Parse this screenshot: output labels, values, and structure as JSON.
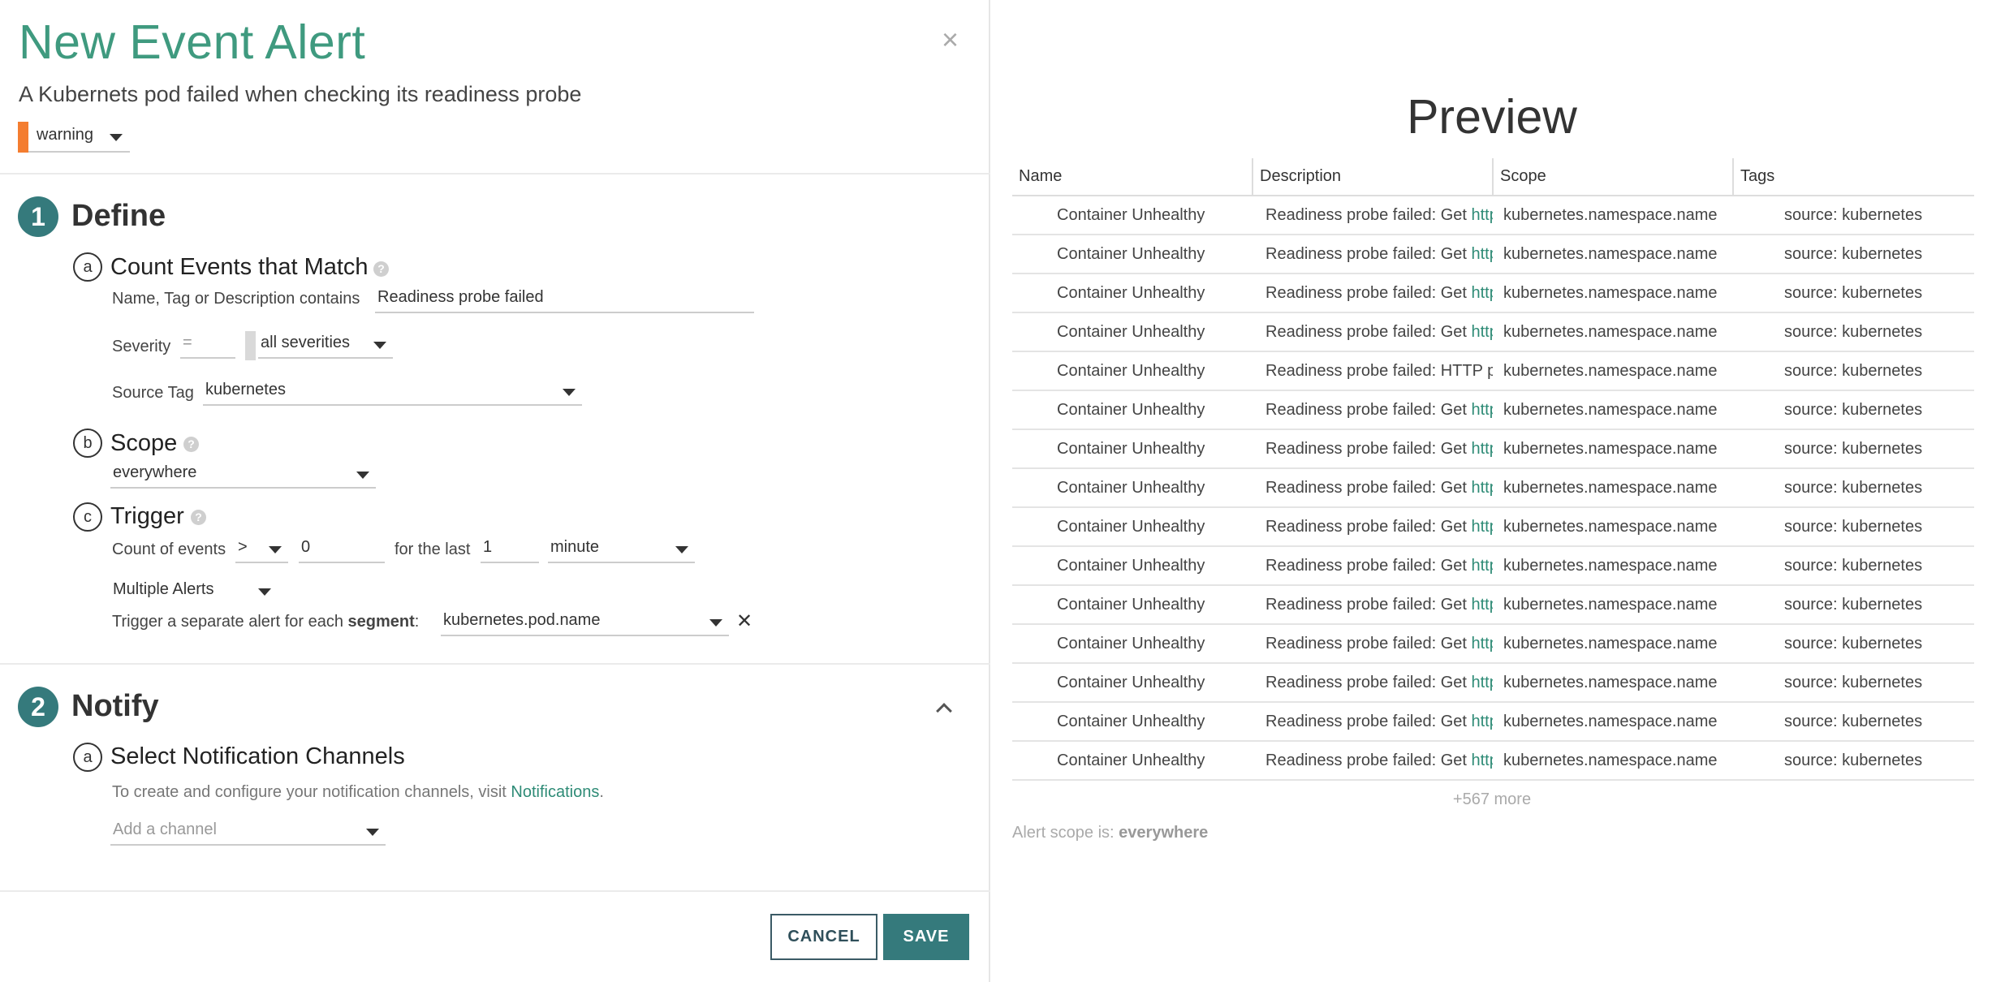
{
  "dialog": {
    "title": "New Event Alert",
    "description": "A Kubernets pod failed when checking its readiness probe",
    "severity": {
      "label": "warning",
      "color": "#f47d30"
    }
  },
  "define": {
    "number": "1",
    "title": "Define",
    "count": {
      "letter": "a",
      "title": "Count Events that Match",
      "match_label": "Name, Tag or Description contains",
      "match_value": "Readiness probe failed",
      "severity_label": "Severity",
      "severity_operator_placeholder": "=",
      "severity_value": "all severities",
      "source_tag_label": "Source Tag",
      "source_tag_value": "kubernetes"
    },
    "scope": {
      "letter": "b",
      "title": "Scope",
      "value": "everywhere"
    },
    "trigger": {
      "letter": "c",
      "title": "Trigger",
      "count_label": "Count of events",
      "operator": ">",
      "threshold": "0",
      "for_label": "for the last",
      "duration": "1",
      "unit": "minute",
      "mode": "Multiple Alerts",
      "segment_prefix": "Trigger a separate alert for each ",
      "segment_bold": "segment",
      "segment_suffix": ":",
      "segment_value": "kubernetes.pod.name"
    }
  },
  "notify": {
    "number": "2",
    "title": "Notify",
    "channels": {
      "letter": "a",
      "title": "Select Notification Channels",
      "help_text": "To create and configure your notification channels, visit ",
      "help_link": "Notifications",
      "help_end": ".",
      "placeholder": "Add a channel"
    }
  },
  "buttons": {
    "cancel": "CANCEL",
    "save": "SAVE"
  },
  "preview": {
    "title": "Preview",
    "columns": [
      "Name",
      "Description",
      "Scope",
      "Tags"
    ],
    "rows": [
      {
        "name": "Container Unhealthy",
        "desc_text": "Readiness probe failed: Get ",
        "desc_link": "http",
        "scope": "kubernetes.namespace.name",
        "tags": "source: kubernetes"
      },
      {
        "name": "Container Unhealthy",
        "desc_text": "Readiness probe failed: Get ",
        "desc_link": "http",
        "scope": "kubernetes.namespace.name",
        "tags": "source: kubernetes"
      },
      {
        "name": "Container Unhealthy",
        "desc_text": "Readiness probe failed: Get ",
        "desc_link": "http",
        "scope": "kubernetes.namespace.name",
        "tags": "source: kubernetes"
      },
      {
        "name": "Container Unhealthy",
        "desc_text": "Readiness probe failed: Get ",
        "desc_link": "http",
        "scope": "kubernetes.namespace.name",
        "tags": "source: kubernetes"
      },
      {
        "name": "Container Unhealthy",
        "desc_text": "Readiness probe failed: HTTP p",
        "desc_link": "",
        "scope": "kubernetes.namespace.name",
        "tags": "source: kubernetes"
      },
      {
        "name": "Container Unhealthy",
        "desc_text": "Readiness probe failed: Get ",
        "desc_link": "http",
        "scope": "kubernetes.namespace.name",
        "tags": "source: kubernetes"
      },
      {
        "name": "Container Unhealthy",
        "desc_text": "Readiness probe failed: Get ",
        "desc_link": "http",
        "scope": "kubernetes.namespace.name",
        "tags": "source: kubernetes"
      },
      {
        "name": "Container Unhealthy",
        "desc_text": "Readiness probe failed: Get ",
        "desc_link": "http",
        "scope": "kubernetes.namespace.name",
        "tags": "source: kubernetes"
      },
      {
        "name": "Container Unhealthy",
        "desc_text": "Readiness probe failed: Get ",
        "desc_link": "http",
        "scope": "kubernetes.namespace.name",
        "tags": "source: kubernetes"
      },
      {
        "name": "Container Unhealthy",
        "desc_text": "Readiness probe failed: Get ",
        "desc_link": "http",
        "scope": "kubernetes.namespace.name",
        "tags": "source: kubernetes"
      },
      {
        "name": "Container Unhealthy",
        "desc_text": "Readiness probe failed: Get ",
        "desc_link": "http",
        "scope": "kubernetes.namespace.name",
        "tags": "source: kubernetes"
      },
      {
        "name": "Container Unhealthy",
        "desc_text": "Readiness probe failed: Get ",
        "desc_link": "http",
        "scope": "kubernetes.namespace.name",
        "tags": "source: kubernetes"
      },
      {
        "name": "Container Unhealthy",
        "desc_text": "Readiness probe failed: Get ",
        "desc_link": "http",
        "scope": "kubernetes.namespace.name",
        "tags": "source: kubernetes"
      },
      {
        "name": "Container Unhealthy",
        "desc_text": "Readiness probe failed: Get ",
        "desc_link": "http",
        "scope": "kubernetes.namespace.name",
        "tags": "source: kubernetes"
      },
      {
        "name": "Container Unhealthy",
        "desc_text": "Readiness probe failed: Get ",
        "desc_link": "http",
        "scope": "kubernetes.namespace.name",
        "tags": "source: kubernetes"
      }
    ],
    "more": "+567 more",
    "scope_note_prefix": "Alert scope is: ",
    "scope_note_value": "everywhere"
  }
}
